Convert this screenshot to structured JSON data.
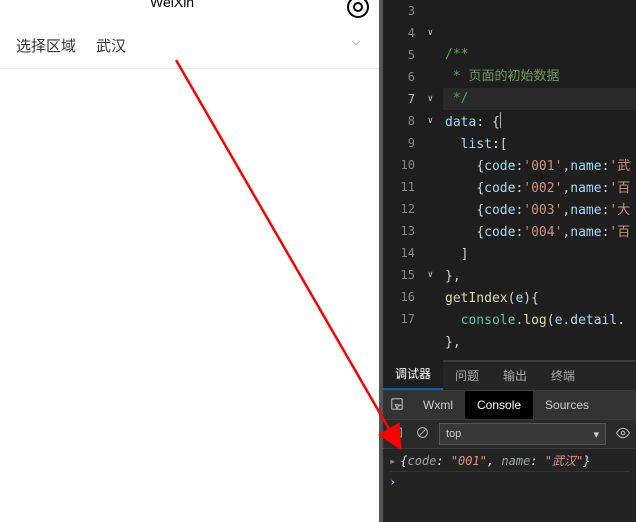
{
  "simulator": {
    "title": "WeiXin",
    "picker": {
      "label": "选择区域",
      "value": "武汉"
    }
  },
  "editor": {
    "lines_start": 3,
    "comment1": "/**",
    "comment2": " * 页面的初始数据",
    "comment3": " */",
    "data_key": "data",
    "list_key": "list",
    "items": [
      {
        "code": "001",
        "name_prefix": "武"
      },
      {
        "code": "002",
        "name_prefix": "百"
      },
      {
        "code": "003",
        "name_prefix": "大"
      },
      {
        "code": "004",
        "name_prefix": "百"
      }
    ],
    "func_name": "getIndex",
    "func_param": "e",
    "console_obj": "console",
    "log_method": "log",
    "log_arg": "e.detail."
  },
  "devtools": {
    "tabs1": [
      "调试器",
      "问题",
      "输出",
      "终端"
    ],
    "active_tab1": 0,
    "tabs2": [
      "Wxml",
      "Console",
      "Sources"
    ],
    "active_tab2": 1,
    "context": "top",
    "log": {
      "code_key": "code",
      "code_val": "\"001\"",
      "name_key": "name",
      "name_val": "\"武汉\""
    }
  }
}
